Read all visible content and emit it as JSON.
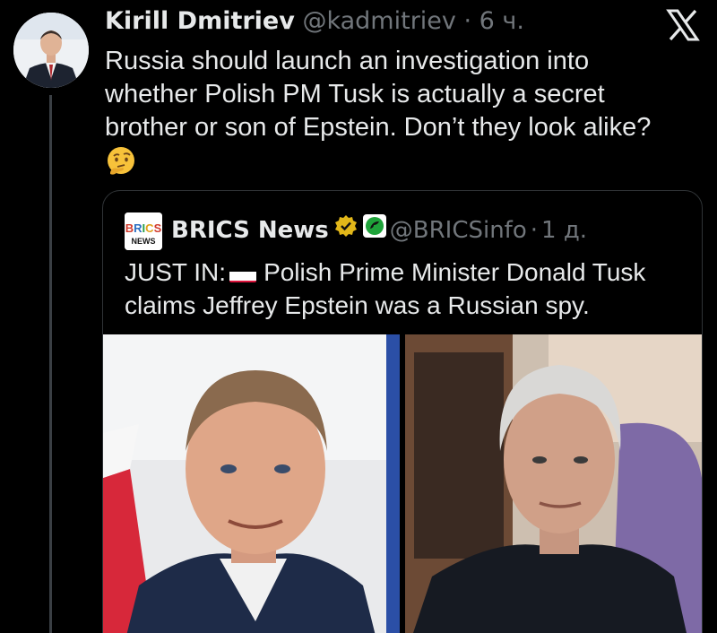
{
  "tweet": {
    "author_name": "Kirill Dmitriev",
    "handle": "@kadmitriev",
    "separator": "·",
    "time": "6 ч.",
    "text_lines": [
      "Russia should launch an investigation into",
      "whether Polish PM Tusk is actually a secret",
      "brother or son of Epstein. Don’t they look alike?"
    ],
    "emoji": "thinking-face"
  },
  "quote": {
    "author_name": "BRICS News",
    "handle": "@BRICSinfo",
    "separator": "·",
    "time": "1 д.",
    "logo_text_top": "BRICS",
    "logo_text_bottom": "NEWS",
    "text_prefix": "JUST IN:",
    "text_line1_rest": "Polish Prime Minister Donald Tusk",
    "text_line2": "claims Jeffrey Epstein was a Russian spy.",
    "flag": "poland-flag",
    "badges": [
      "gold-verified-badge",
      "green-affiliate-badge"
    ]
  },
  "icons": {
    "close": "x-logo-icon"
  },
  "colors": {
    "background": "#000000",
    "text": "#e7e9ea",
    "muted": "#71767b",
    "border": "#2f3336",
    "verified_gold": "#e2b719",
    "affiliate_green": "#1fa33a"
  }
}
